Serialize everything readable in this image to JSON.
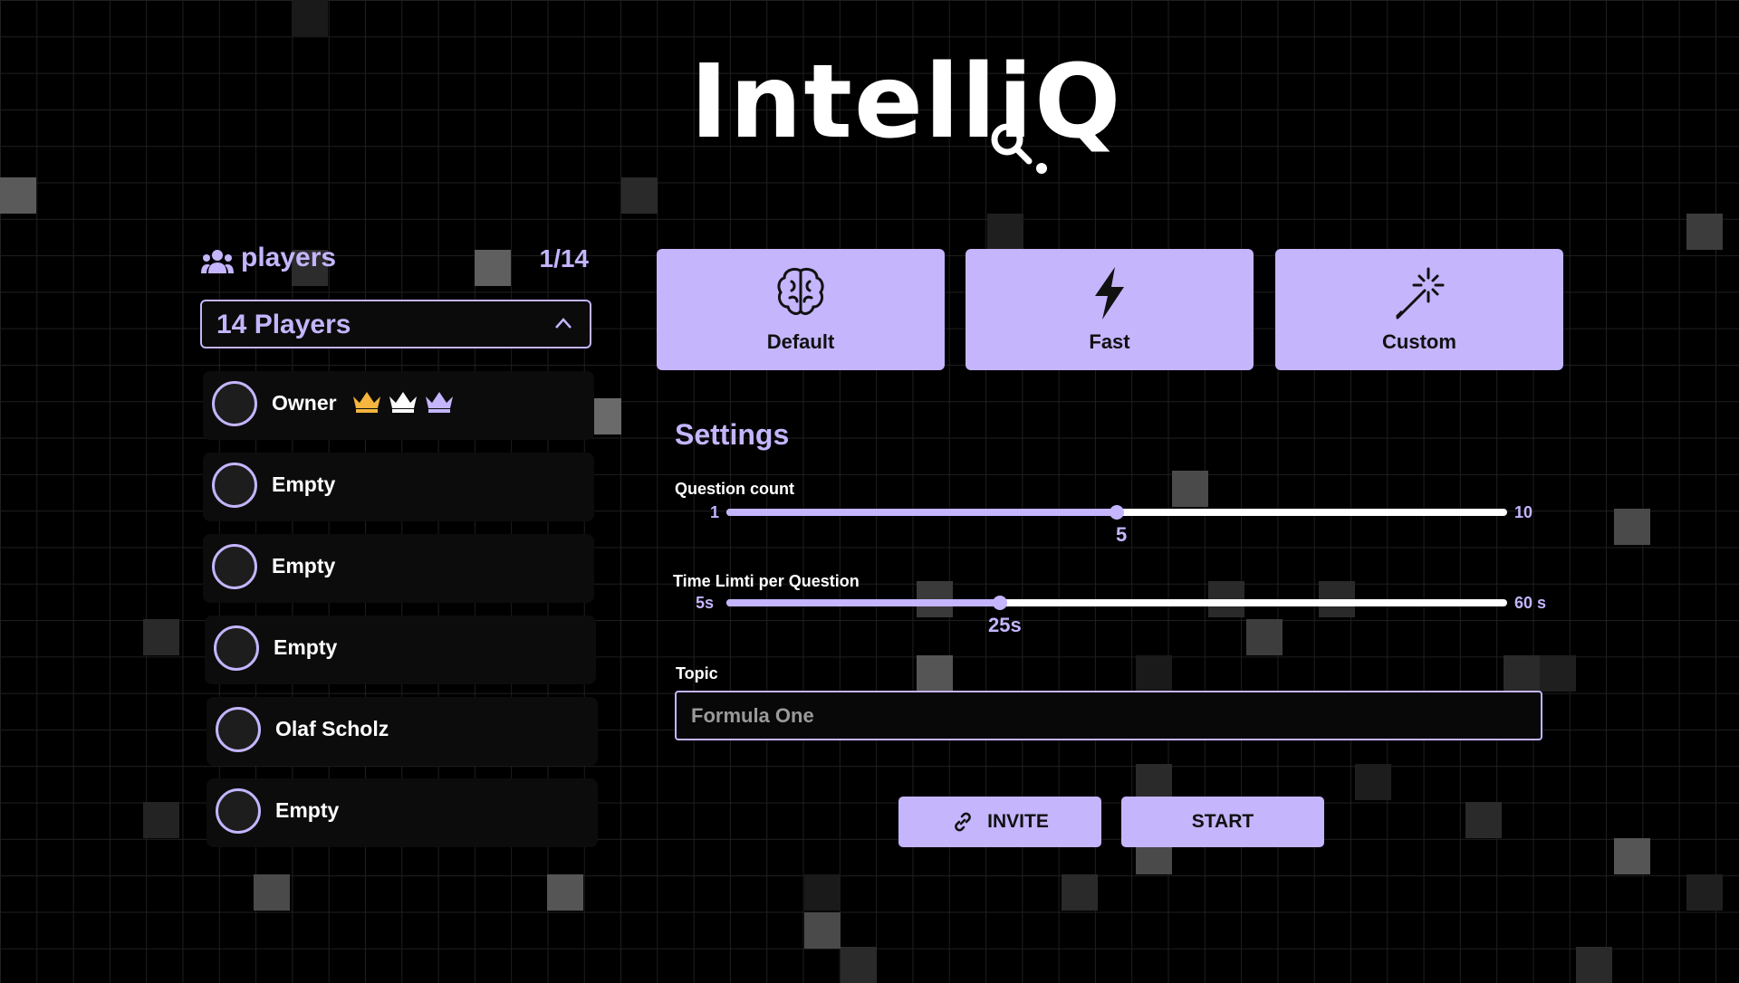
{
  "app": {
    "logo_text": "IntelliQ"
  },
  "players": {
    "title": "players",
    "count": "1/14",
    "select_value": "14 Players",
    "slots": [
      {
        "name": "Owner"
      },
      {
        "name": "Empty"
      },
      {
        "name": "Empty"
      },
      {
        "name": "Empty"
      },
      {
        "name": "Olaf Scholz"
      },
      {
        "name": "Empty"
      }
    ]
  },
  "modes": [
    {
      "label": "Default",
      "icon": "brain-icon"
    },
    {
      "label": "Fast",
      "icon": "lightning-icon"
    },
    {
      "label": "Custom",
      "icon": "magic-wand-icon"
    }
  ],
  "settings": {
    "title": "Settings",
    "question_count": {
      "label": "Question count",
      "min": "1",
      "max": "10",
      "value": "5",
      "fraction": 0.5
    },
    "time_limit": {
      "label": "Time Limti per Question",
      "min": "5s",
      "max": "60 s",
      "value": "25s",
      "fraction": 0.35
    },
    "topic": {
      "label": "Topic",
      "value": "Formula One"
    }
  },
  "actions": {
    "invite": "INVITE",
    "start": "START"
  },
  "colors": {
    "accent": "#c4b5fd",
    "background": "#000000",
    "crown_gold": "#f5b53f",
    "crown_white": "#ffffff",
    "crown_purple": "#c4b5fd"
  }
}
